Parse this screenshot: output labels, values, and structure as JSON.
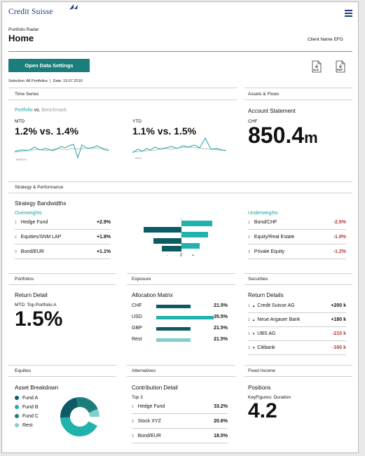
{
  "brand": {
    "name": "Credit Suisse"
  },
  "header": {
    "subtitle": "Portfolio Radar",
    "title": "Home",
    "client": "Client Name EFG"
  },
  "toolbar": {
    "open_settings": "Open Data Settings",
    "xls": "XLS",
    "pdf": "PDF"
  },
  "selection": "Selection: All Portfolios  |  Date: 19.07.2016",
  "time_series": {
    "section": "Time Series",
    "portfolio": "Portfolio",
    "vs": "vs.",
    "benchmark": "Benchmark",
    "mtd": {
      "label": "MTD",
      "value": "1.2% vs. 1.4%",
      "axis": "MARCH"
    },
    "ytd": {
      "label": "YTD",
      "value": "1.1% vs. 1.5%",
      "axis": "2016"
    }
  },
  "assets_flows": {
    "section": "Assets & Flows",
    "heading": "Account Statement",
    "currency": "CHF",
    "value": "850.4",
    "unit": "m"
  },
  "strategy": {
    "section": "Strategy & Performance",
    "heading": "Strategy Bandwidths",
    "overweights_label": "Overweights",
    "underweights_label": "Underweights",
    "overweights": [
      {
        "n": "1",
        "name": "Hedge Fund",
        "value": "+2.9%"
      },
      {
        "n": "2",
        "name": "Equities/SNM LAP",
        "value": "+1.8%"
      },
      {
        "n": "3",
        "name": "Bond/EUR",
        "value": "+1.1%"
      }
    ],
    "underweights": [
      {
        "n": "1",
        "name": "Bond/CHF",
        "value": "-2.6%"
      },
      {
        "n": "2",
        "name": "Equity/Real Estate",
        "value": "-1.9%"
      },
      {
        "n": "3",
        "name": "Private Equity",
        "value": "-1.2%"
      }
    ],
    "axis": {
      "minus": "-",
      "zero": "0",
      "plus": "+"
    }
  },
  "portfolios": {
    "section": "Portfolios",
    "heading": "Return Detail",
    "sub": "MTD: Top Portfolio A",
    "value": "1.5%"
  },
  "exposure": {
    "section": "Exposure",
    "heading": "Allocation Matrix",
    "rows": [
      {
        "label": "CHF",
        "value": "21.5%",
        "level": 0.6
      },
      {
        "label": "USD",
        "value": "35.5%",
        "level": 1.0
      },
      {
        "label": "GBP",
        "value": "21.5%",
        "level": 0.6
      },
      {
        "label": "Rest",
        "value": "21.5%",
        "level": 0.6
      }
    ]
  },
  "securities": {
    "section": "Securities",
    "heading": "Return Details",
    "rows": [
      {
        "n": "1",
        "name": "Credit Suisse AG",
        "value": "+200 k"
      },
      {
        "n": "2",
        "name": "Neue Argauer Bank",
        "value": "+180 k"
      },
      {
        "n": "1",
        "name": "UBS AG",
        "value": "-210 k"
      },
      {
        "n": "2",
        "name": "Citibank",
        "value": "-160 k"
      }
    ]
  },
  "equities": {
    "section": "Equities",
    "heading": "Asset Breakdown",
    "legend": [
      {
        "name": "Fund A",
        "color": "#0c5a63"
      },
      {
        "name": "Fund B",
        "color": "#21b3ab"
      },
      {
        "name": "Fund C",
        "color": "#1b7e7a"
      },
      {
        "name": "Rest",
        "color": "#7fd0cb"
      }
    ]
  },
  "alternatives": {
    "section": "Alternatives",
    "heading": "Contribution Detail",
    "sub": "Top 3",
    "rows": [
      {
        "n": "1",
        "name": "Hedge Fund",
        "value": "33.2%"
      },
      {
        "n": "2",
        "name": "Stock XYZ",
        "value": "20.6%"
      },
      {
        "n": "3",
        "name": "Bond/EUR",
        "value": "18.5%"
      }
    ]
  },
  "fixed_income": {
    "section": "Fixed Income",
    "heading": "Positions",
    "sub": "KeyFigures: Duration",
    "value": "4.2"
  },
  "colors": {
    "teal": "#1fa3a0",
    "dark_teal": "#0c5a63",
    "button": "#1b7e7a",
    "negative": "#b23a3a"
  }
}
